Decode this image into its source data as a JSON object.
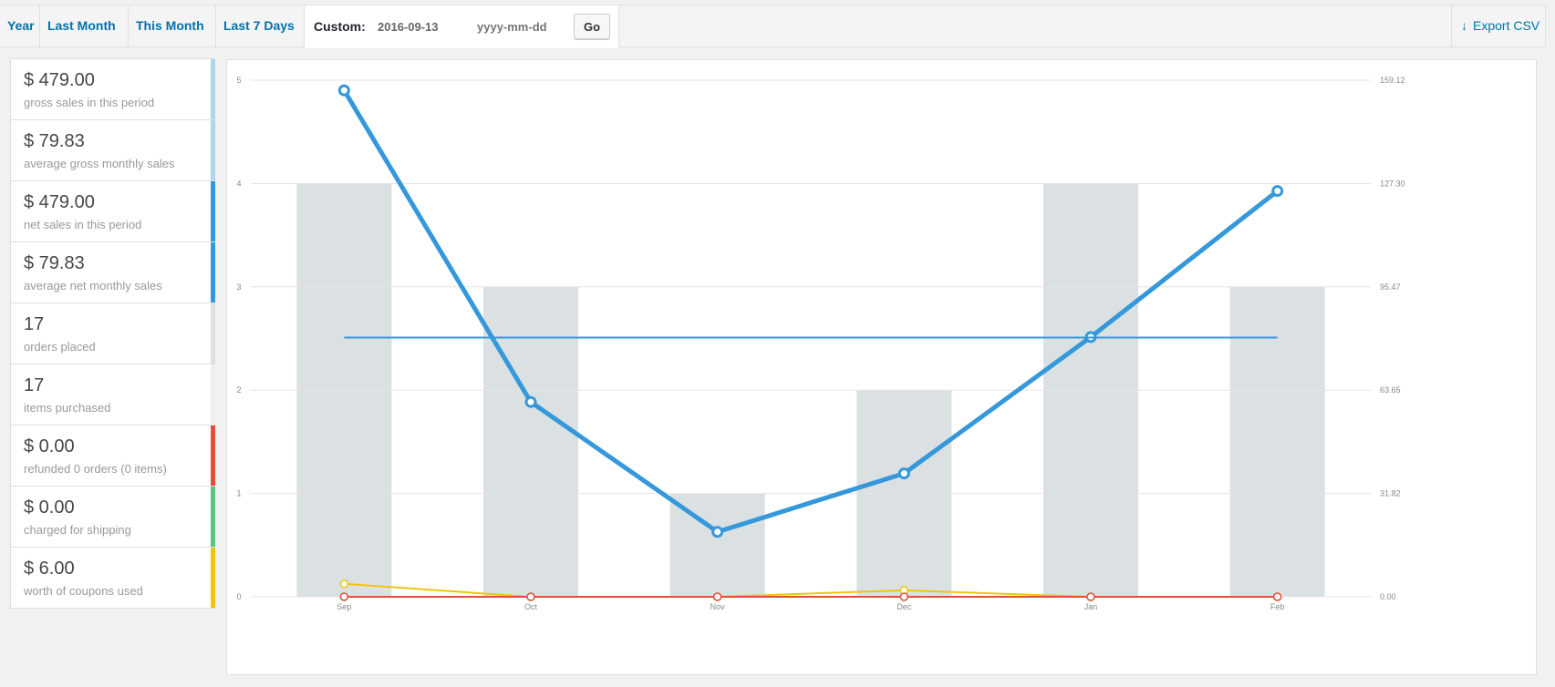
{
  "toolbar": {
    "tabs": [
      "Year",
      "Last Month",
      "This Month",
      "Last 7 Days"
    ],
    "custom_label": "Custom:",
    "start_value": "2016-09-13",
    "end_placeholder": "yyyy-mm-dd",
    "go_label": "Go",
    "export_label": "Export CSV"
  },
  "legend": [
    {
      "amount": "$ 479.00",
      "label": "gross sales in this period",
      "color": "#b1d4ea"
    },
    {
      "amount": "$ 79.83",
      "label": "average gross monthly sales",
      "color": "#b1d4ea"
    },
    {
      "amount": "$ 479.00",
      "label": "net sales in this period",
      "color": "#3498db"
    },
    {
      "amount": "$ 79.83",
      "label": "average net monthly sales",
      "color": "#3498db"
    },
    {
      "amount": "17",
      "label": "orders placed",
      "color": "#dbe1e3"
    },
    {
      "amount": "17",
      "label": "items purchased",
      "color": "#ecf0f1"
    },
    {
      "amount": "$ 0.00",
      "label": "refunded 0 orders (0 items)",
      "color": "#e74c3c"
    },
    {
      "amount": "$ 0.00",
      "label": "charged for shipping",
      "color": "#5cc488"
    },
    {
      "amount": "$ 6.00",
      "label": "worth of coupons used",
      "color": "#f1c40f"
    }
  ],
  "chart_data": {
    "type": "bar",
    "categories": [
      "Sep",
      "Oct",
      "Nov",
      "Dec",
      "Jan",
      "Feb"
    ],
    "left_axis": {
      "ticks": [
        "0",
        "1",
        "2",
        "3",
        "4",
        "5"
      ],
      "ylim": [
        0,
        5
      ]
    },
    "right_axis": {
      "ticks": [
        "0.00",
        "31.82",
        "63.65",
        "95.47",
        "127.30",
        "159.12"
      ],
      "ylim": [
        0,
        159.12
      ]
    },
    "bars": {
      "axis": "left",
      "color": "#dbe1e3",
      "values": [
        4,
        3,
        1,
        2,
        4,
        3
      ]
    },
    "lines": [
      {
        "axis": "right",
        "color": "#3498db",
        "width": 5,
        "values": [
          156,
          60,
          20,
          38,
          80,
          125
        ]
      },
      {
        "axis": "right",
        "color": "#3498db",
        "width": 2,
        "flat": true,
        "values": [
          79.83,
          79.83,
          79.83,
          79.83,
          79.83,
          79.83
        ]
      },
      {
        "axis": "right",
        "color": "#f1c40f",
        "width": 2,
        "values": [
          4,
          0,
          0,
          2,
          0,
          0
        ]
      },
      {
        "axis": "right",
        "color": "#e74c3c",
        "width": 2,
        "values": [
          0,
          0,
          0,
          0,
          0,
          0
        ]
      }
    ],
    "grid": true
  }
}
